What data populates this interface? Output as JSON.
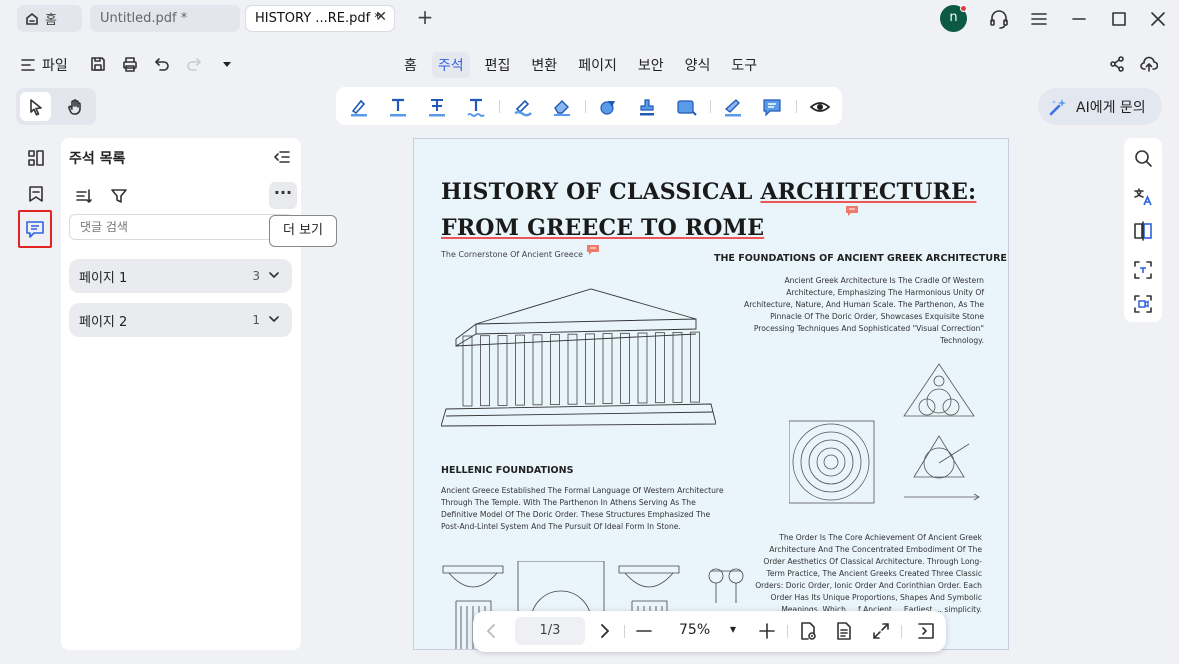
{
  "tabs": {
    "home": "홈",
    "untitled": "Untitled.pdf *",
    "history": "HISTORY ...RE.pdf *",
    "close": "✕",
    "new_tab": "+"
  },
  "account": {
    "initial": "n"
  },
  "menu": {
    "file": "파일",
    "tabs": [
      "홈",
      "주석",
      "편집",
      "변환",
      "페이지",
      "보안",
      "양식",
      "도구"
    ],
    "active_tab": "주석"
  },
  "ai": {
    "label": "AI에게 문의"
  },
  "panel": {
    "title": "주석 목록",
    "search_placeholder": "댓글 검색",
    "more": "···",
    "tooltip": "더 보기",
    "groups": [
      {
        "label": "페이지 1",
        "count": "3"
      },
      {
        "label": "페이지 2",
        "count": "1"
      }
    ]
  },
  "document": {
    "title_line1_a": "HISTORY OF CLASSICAL ",
    "title_line1_b": "ARCHITECTURE:",
    "title_line2_a": "FROM GREECE TO ",
    "title_line2_b": "ROME",
    "subtitle": "The Cornerstone Of Ancient Greece",
    "sec1_head": "THE FOUNDATIONS OF ANCIENT GREEK ARCHITECTURE",
    "sec1_body": "Ancient Greek Architecture Is The Cradle Of Western Architecture, Emphasizing The Harmonious Unity Of Architecture, Nature, And Human Scale. The Parthenon, As The Pinnacle Of The Doric Order, Showcases Exquisite Stone Processing Techniques And Sophisticated \"Visual Correction\" Technology.",
    "sec2_head": "HELLENIC FOUNDATIONS",
    "sec2_body": "Ancient Greece Established The Formal Language Of Western Architecture Through The Temple. With The Parthenon In Athens Serving As The Definitive Model Of The Doric Order. These Structures Emphasized The Post-And-Lintel System And The Pursuit Of Ideal Form In Stone.",
    "sec3_body": "The Order Is The Core Achievement Of Ancient Greek Architecture And The Concentrated Embodiment Of The Order Aesthetics Of Classical Architecture. Through Long-Term Practice, The Ancient Greeks Created Three Classic Orders: Doric Order, Ionic Order And Corinthian Order. Each Order Has Its Unique Proportions, Shapes And Symbolic Meanings, Which ... f Ancient ... Earliest ... simplicity."
  },
  "nav": {
    "page": "1/3",
    "zoom": "75%",
    "zoom_caret": "▾"
  },
  "colors": {
    "accent": "#2f62e0",
    "highlight_red": "#e02424",
    "page_bg": "#e9f4fb",
    "avatar": "#0d5a44"
  }
}
